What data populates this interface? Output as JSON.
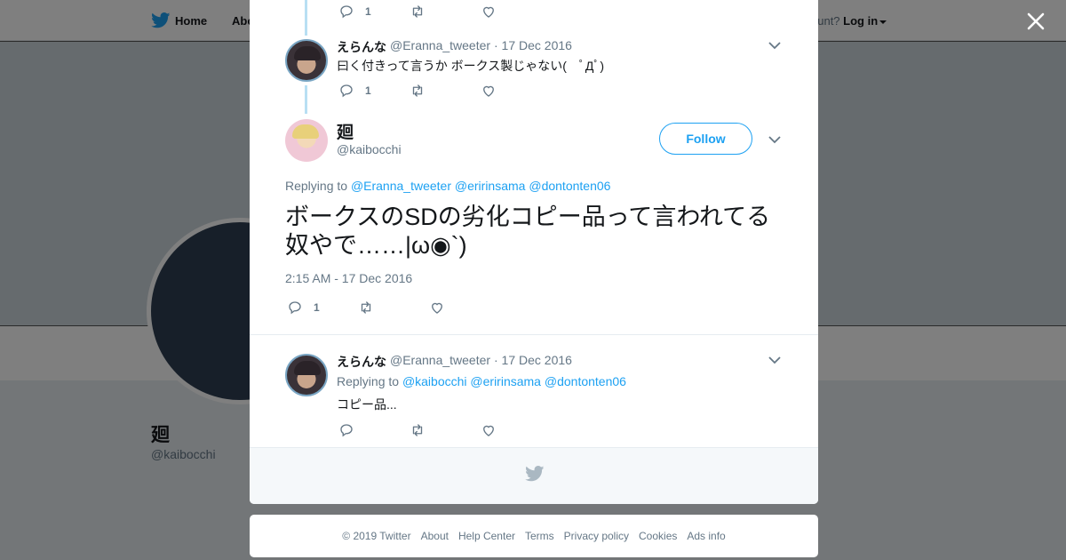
{
  "nav": {
    "home": "Home",
    "about": "Abo",
    "account_prompt": "ccount?",
    "login": "Log in"
  },
  "profile": {
    "name": "廻",
    "handle": "@kaibocchi"
  },
  "tweets": [
    {
      "reply_count": "1"
    },
    {
      "name": "えらんな",
      "handle": "@Eranna_tweeter",
      "date": "· 17 Dec 2016",
      "text": "曰く付きって言うか ボークス製じゃない(　ﾟДﾟ)",
      "reply_count": "1"
    }
  ],
  "main_tweet": {
    "name": "廻",
    "handle": "@kaibocchi",
    "follow_label": "Follow",
    "replying_label": "Replying to",
    "mentions": [
      "@Eranna_tweeter",
      "@eririnsama",
      "@dontonten06"
    ],
    "text": "ボークスのSDの劣化コピー品って言われてる奴やで……|ω◉`)",
    "timestamp": "2:15 AM - 17 Dec 2016",
    "reply_count": "1"
  },
  "reply": {
    "name": "えらんな",
    "handle": "@Eranna_tweeter",
    "date": "· 17 Dec 2016",
    "replying_label": "Replying to",
    "mentions": [
      "@kaibocchi",
      "@eririnsama",
      "@dontonten06"
    ],
    "text": "コピー品..."
  },
  "footer": {
    "copyright": "© 2019 Twitter",
    "links": [
      "About",
      "Help Center",
      "Terms",
      "Privacy policy",
      "Cookies",
      "Ads info"
    ]
  },
  "colors": {
    "accent": "#1da1f2",
    "muted": "#657786",
    "thread_line": "#b8dff3"
  }
}
